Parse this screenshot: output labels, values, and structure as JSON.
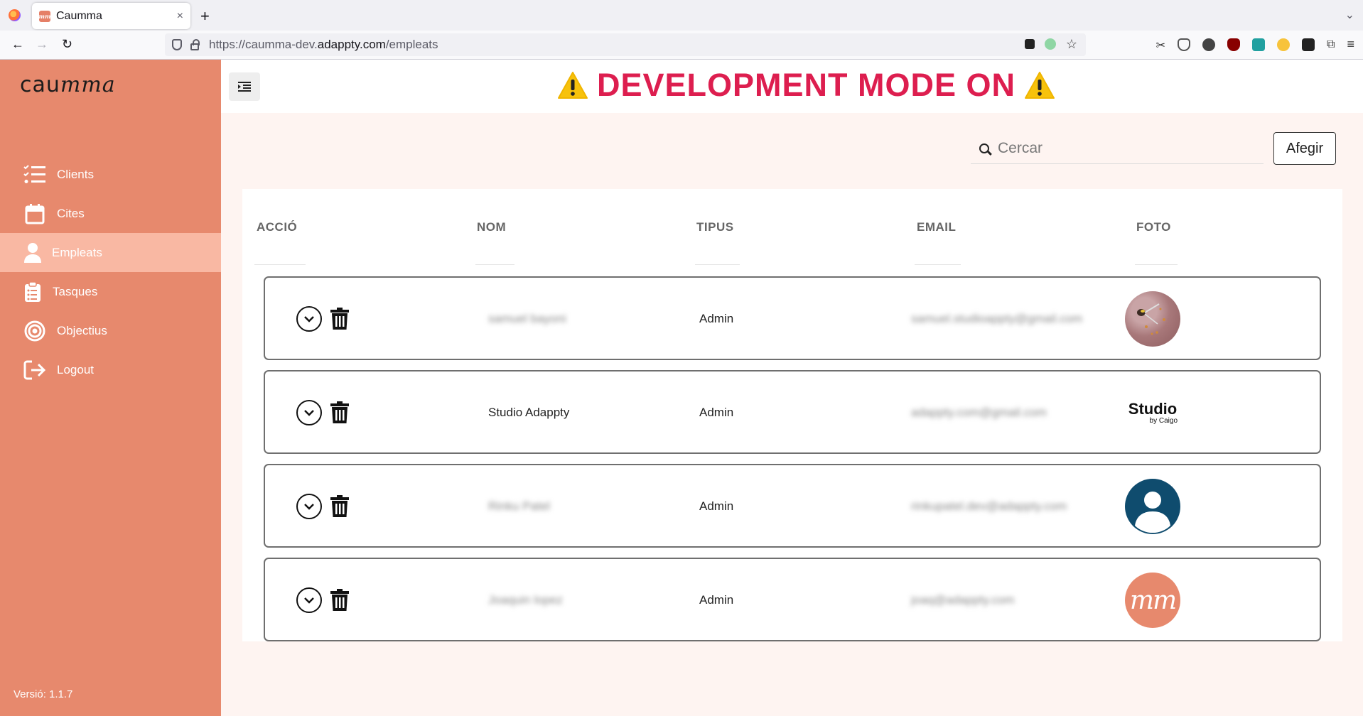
{
  "browser": {
    "tab_title": "Caumma",
    "tab_favicon_text": "mm",
    "url_prefix": "https://caumma-dev.",
    "url_domain": "adappty.com",
    "url_path": "/empleats",
    "new_tab": "+",
    "close_tab": "×",
    "tab_list": "⌄"
  },
  "app": {
    "brand_a": "cau",
    "brand_b": "mma",
    "dev_banner": "DEVELOPMENT MODE ON",
    "menu": [
      {
        "label": "Clients",
        "icon": "list-check-icon"
      },
      {
        "label": "Cites",
        "icon": "calendar-icon"
      },
      {
        "label": "Empleats",
        "icon": "user-icon",
        "active": true
      },
      {
        "label": "Tasques",
        "icon": "clipboard-icon"
      },
      {
        "label": "Objectius",
        "icon": "target-icon"
      },
      {
        "label": "Logout",
        "icon": "logout-icon"
      }
    ],
    "version": "Versió: 1.1.7",
    "search_placeholder": "Cercar",
    "add_label": "Afegir",
    "columns": [
      "ACCIÓ",
      "NOM",
      "TIPUS",
      "EMAIL",
      "FOTO"
    ],
    "rows": [
      {
        "name": "samuel bayoni",
        "type": "Admin",
        "email": "samuel.studioappty@gmail.com",
        "photo": "bird-photo",
        "blurred": true
      },
      {
        "name": "Studio Adappty",
        "type": "Admin",
        "email": "adappty.com@gmail.com",
        "photo": "studio-logo",
        "blurred_email": true,
        "logo_title": "Studio",
        "logo_sub": "by Caigo"
      },
      {
        "name": "Rinku Patel",
        "type": "Admin",
        "email": "rinkupatel.dev@adappty.com",
        "photo": "default-avatar",
        "blurred": true
      },
      {
        "name": "Joaquin lopez",
        "type": "Admin",
        "email": "joaq@adappty.com",
        "photo": "caumma-logo",
        "blurred": true,
        "logo_text": "mm"
      }
    ]
  },
  "colors": {
    "sidebar": "#e7896d",
    "sidebar_active": "#f9b8a3",
    "dev_banner": "#dd1e4f",
    "content_bg": "#fef4f1"
  }
}
